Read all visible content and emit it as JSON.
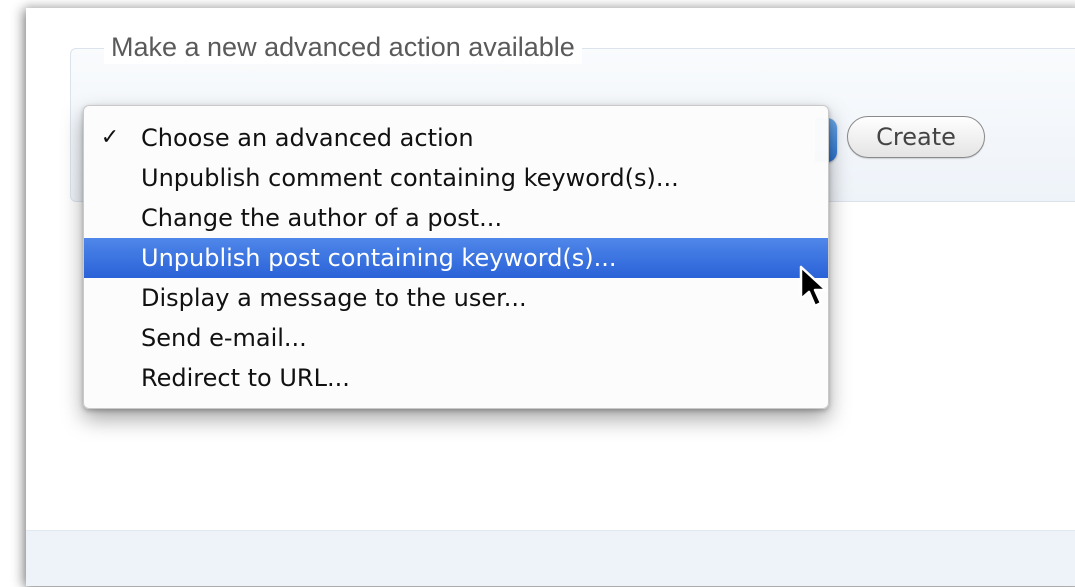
{
  "fieldset": {
    "legend": "Make a new advanced action available"
  },
  "create_button": {
    "label": "Create"
  },
  "dropdown": {
    "selected": "Choose an advanced action",
    "highlighted": "Unpublish post containing keyword(s)...",
    "check_mark": "✓",
    "options": [
      "Choose an advanced action",
      "Unpublish comment containing keyword(s)...",
      "Change the author of a post...",
      "Unpublish post containing keyword(s)...",
      "Display a message to the user...",
      "Send e-mail...",
      "Redirect to URL..."
    ]
  },
  "colors": {
    "highlight": "#2a62d8",
    "footer": "#eef3f9"
  },
  "icons": {
    "pointer": "arrow-cursor-icon"
  }
}
